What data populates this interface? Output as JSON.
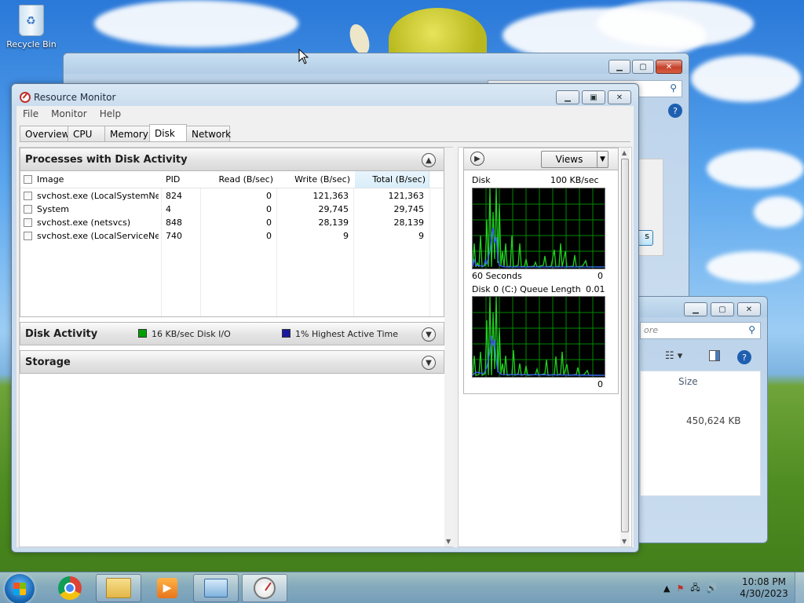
{
  "desktop": {
    "recycle_bin_label": "Recycle Bin"
  },
  "window": {
    "title": "Resource Monitor",
    "menu": [
      "File",
      "Monitor",
      "Help"
    ],
    "tabs": [
      "Overview",
      "CPU",
      "Memory",
      "Disk",
      "Network"
    ],
    "active_tab": "Disk"
  },
  "processes": {
    "title": "Processes with Disk Activity",
    "columns": [
      "Image",
      "PID",
      "Read (B/sec)",
      "Write (B/sec)",
      "Total (B/sec)"
    ],
    "sorted_column": "Total (B/sec)",
    "rows": [
      {
        "image": "svchost.exe (LocalSystemNet...",
        "pid": "824",
        "read": "0",
        "write": "121,363",
        "total": "121,363"
      },
      {
        "image": "System",
        "pid": "4",
        "read": "0",
        "write": "29,745",
        "total": "29,745"
      },
      {
        "image": "svchost.exe (netsvcs)",
        "pid": "848",
        "read": "0",
        "write": "28,139",
        "total": "28,139"
      },
      {
        "image": "svchost.exe (LocalServiceNet...",
        "pid": "740",
        "read": "0",
        "write": "9",
        "total": "9"
      }
    ]
  },
  "disk_activity": {
    "title": "Disk Activity",
    "io_label": "16 KB/sec Disk I/O",
    "active_label": "1% Highest Active Time",
    "io_color": "#00a000",
    "active_color": "#1a1aa0"
  },
  "storage": {
    "title": "Storage"
  },
  "graphs": {
    "views_label": "Views",
    "disk": {
      "title": "Disk",
      "scale": "100 KB/sec",
      "footer_left": "60 Seconds",
      "footer_right": "0"
    },
    "queue": {
      "title": "Disk 0 (C:) Queue Length",
      "scale": "0.01",
      "footer_right": "0"
    }
  },
  "background_window": {
    "size_header": "Size",
    "size_value": "450,624 KB",
    "search_placeholder": "ore"
  },
  "taskbar": {
    "time": "10:08 PM",
    "date": "4/30/2023"
  },
  "colors": {
    "graph_bg": "#000000",
    "grid": "#008a00",
    "io_line": "#22d022",
    "active_line": "#3a5fff"
  }
}
